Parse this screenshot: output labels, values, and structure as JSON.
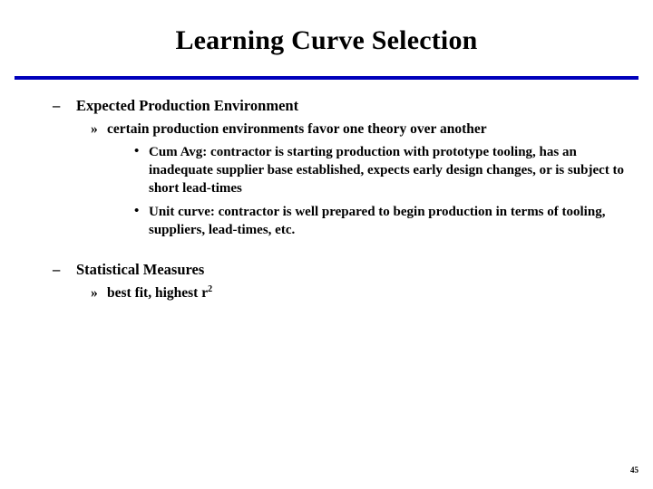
{
  "slide": {
    "title": "Learning Curve Selection",
    "page_number": "45",
    "accent_color": "#0000bb",
    "bullets": {
      "dash": "–",
      "guillemet": "»",
      "dot": "•"
    },
    "sections": [
      {
        "level1": "Expected Production Environment",
        "level2": "certain production environments favor one theory over another",
        "level3": [
          "Cum Avg:  contractor is starting production with prototype tooling, has an inadequate supplier base established, expects early design changes, or is subject to short lead-times",
          "Unit curve:  contractor is well prepared to begin production in terms of tooling, suppliers, lead-times, etc."
        ]
      },
      {
        "level1": "Statistical Measures",
        "level2_prefix": "best fit, highest r",
        "level2_superscript": "2"
      }
    ]
  }
}
